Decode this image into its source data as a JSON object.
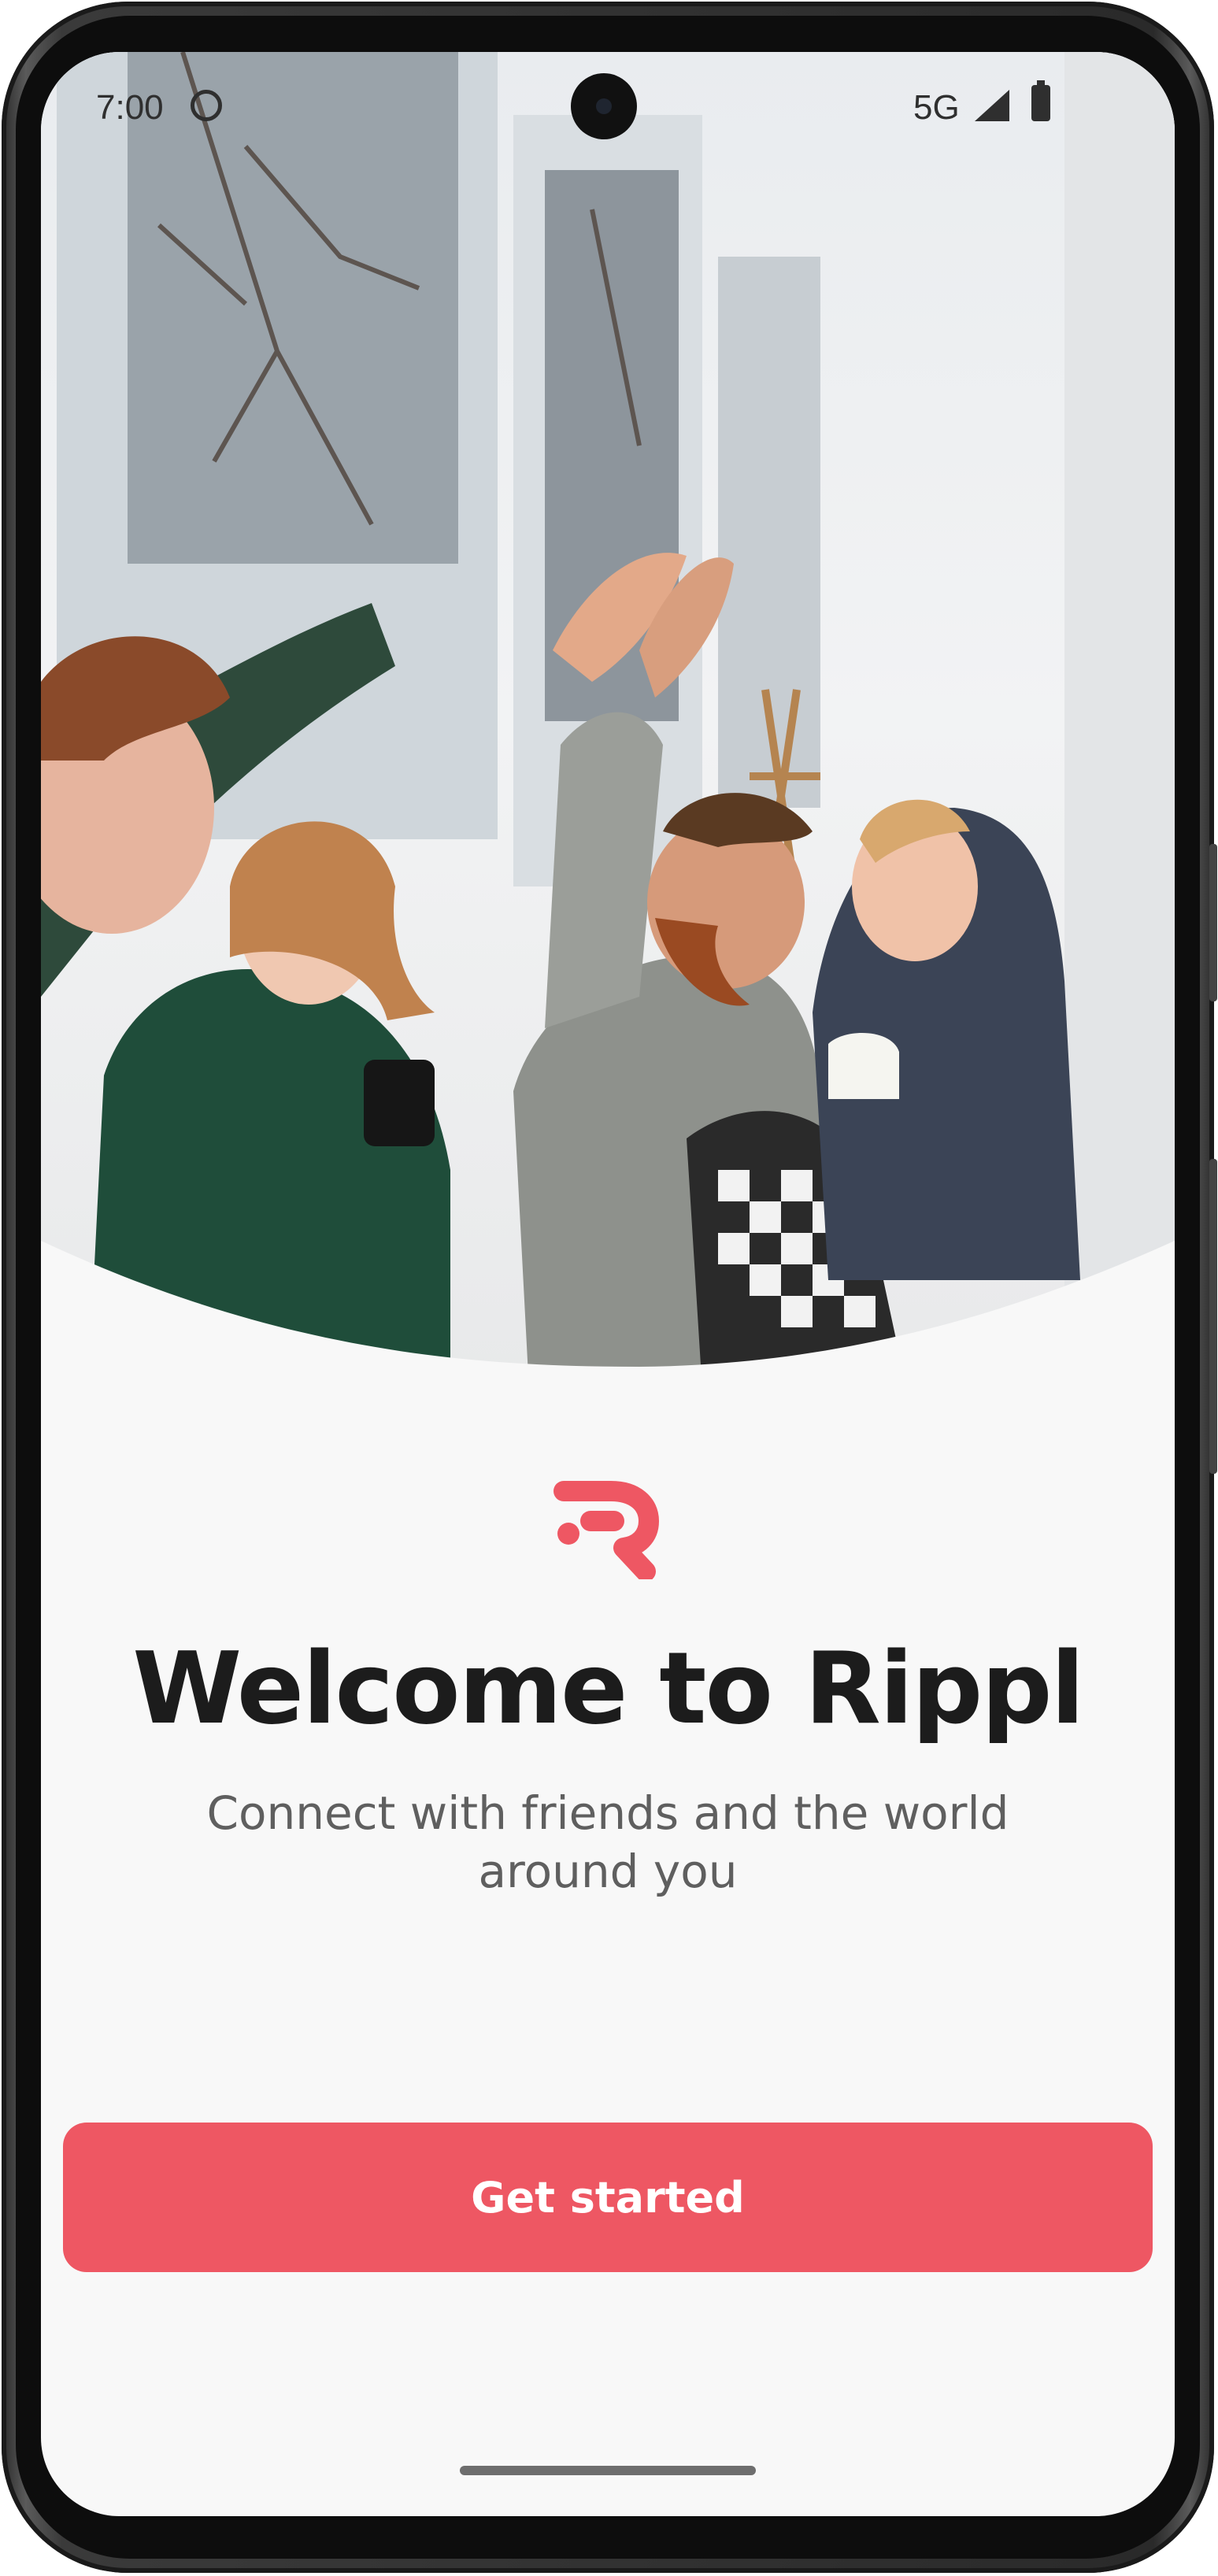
{
  "status_bar": {
    "time": "7:00",
    "network": "5G"
  },
  "welcome": {
    "title": "Welcome to Rippl",
    "subtitle": "Connect with friends and the world around you",
    "cta_label": "Get started"
  },
  "theme": {
    "accent": "#ee5763",
    "title_color": "#1c1c1c",
    "subtitle_color": "#5f5f5f",
    "background": "#f8f8f8"
  },
  "icons": {
    "logo": "rippl-logo-icon",
    "status_face": "face-icon",
    "signal": "signal-icon",
    "battery": "battery-icon"
  }
}
